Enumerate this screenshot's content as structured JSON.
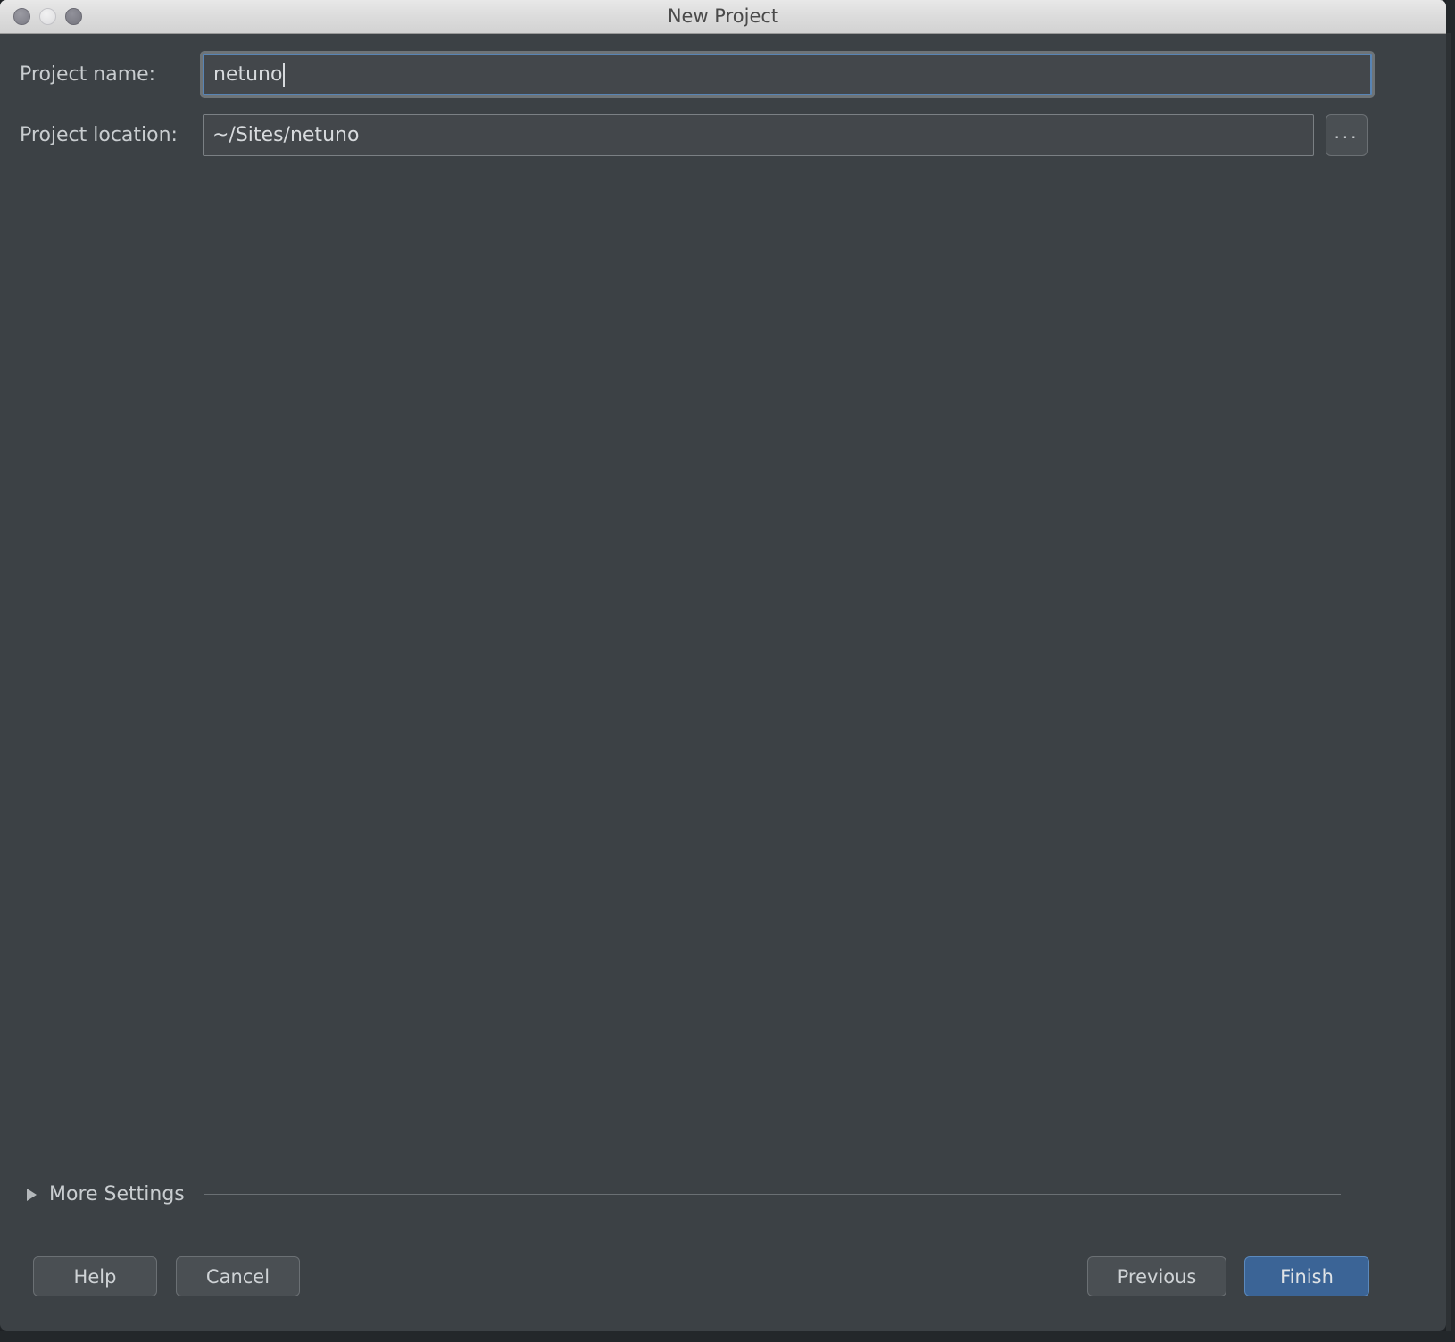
{
  "window": {
    "title": "New Project",
    "controls": {
      "close": "close-button",
      "minimize": "minimize-button",
      "maximize": "maximize-button"
    }
  },
  "form": {
    "project_name": {
      "label": "Project name:",
      "value": "netuno",
      "placeholder": ""
    },
    "project_location": {
      "label": "Project location:",
      "value": "~/Sites/netuno",
      "placeholder": "",
      "browse_label": "..."
    }
  },
  "more_settings": {
    "label": "More Settings",
    "expanded": false,
    "disclosure_icon": "triangle-right-icon"
  },
  "footer": {
    "help_label": "Help",
    "cancel_label": "Cancel",
    "previous_label": "Previous",
    "finish_label": "Finish"
  },
  "colors": {
    "dialog_background": "#3c4145",
    "titlebar_background": "#dcdcdc",
    "field_background": "#43474b",
    "focus_border": "#5884b4",
    "default_button": "#3b6496",
    "text_primary": "#c9cdd0"
  }
}
